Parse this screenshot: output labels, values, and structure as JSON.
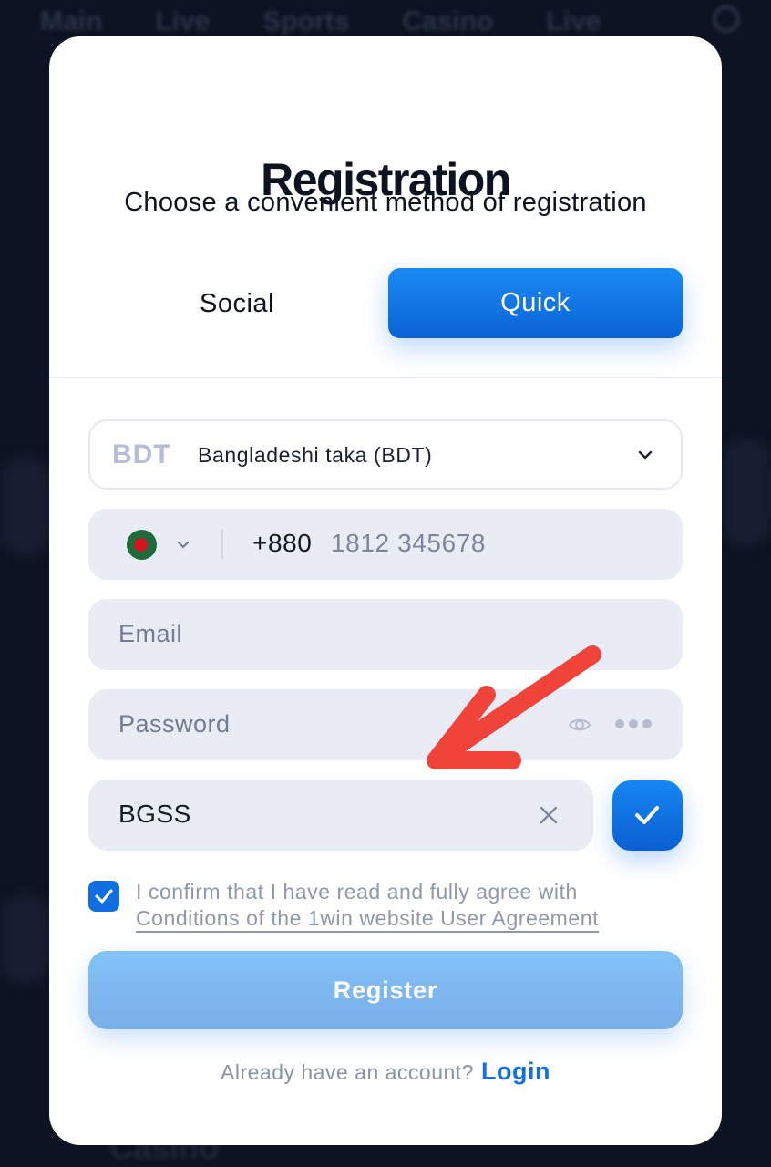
{
  "background": {
    "nav": [
      "Main",
      "Live",
      "Sports",
      "Casino",
      "Live"
    ],
    "bottom_text": "Casino"
  },
  "modal": {
    "title": "Registration",
    "subtitle": "Choose a convenient method of registration",
    "tabs": [
      {
        "label": "Social",
        "active": false
      },
      {
        "label": "Quick",
        "active": true
      }
    ],
    "currency": {
      "code": "BDT",
      "name": "Bangladeshi taka (BDT)"
    },
    "phone": {
      "country_code": "+880",
      "placeholder": "1812 345678",
      "flag": "bangladesh-flag"
    },
    "email": {
      "placeholder": "Email"
    },
    "password": {
      "placeholder": "Password"
    },
    "promo": {
      "value": "BGSS"
    },
    "agreement": {
      "checked": true,
      "text": "I confirm that I have read and fully agree with",
      "link": "Conditions of the 1win website User Agreement"
    },
    "register_label": "Register",
    "footer": {
      "question": "Already have an account?",
      "login_label": "Login"
    }
  },
  "colors": {
    "accent": "#0f6fe0",
    "annotation_arrow": "#f0443a",
    "backdrop": "#0d1322"
  }
}
